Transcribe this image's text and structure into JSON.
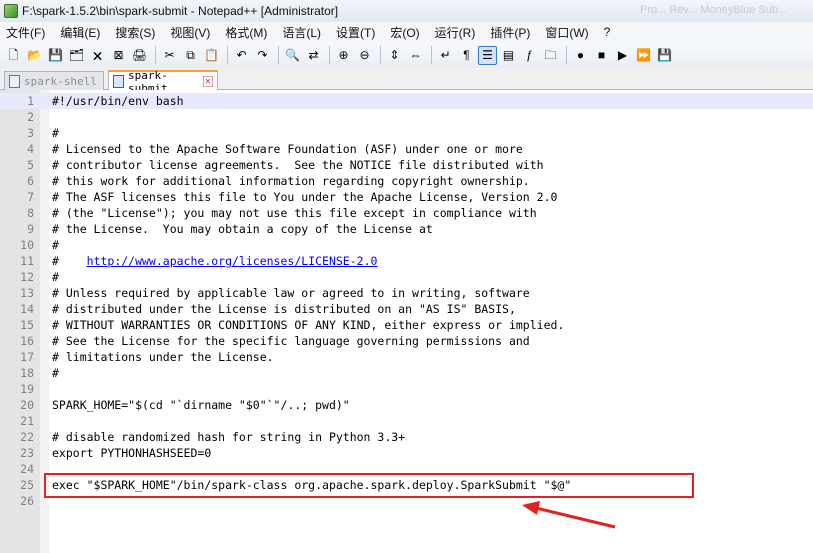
{
  "window": {
    "title": "F:\\spark-1.5.2\\bin\\spark-submit - Notepad++ [Administrator]",
    "ghost_text": "Pro... Rev... MoneyBlue Sub..."
  },
  "menu": [
    "文件(F)",
    "编辑(E)",
    "搜索(S)",
    "视图(V)",
    "格式(M)",
    "语言(L)",
    "设置(T)",
    "宏(O)",
    "运行(R)",
    "插件(P)",
    "窗口(W)",
    "?"
  ],
  "toolbar": {
    "icons": [
      "new-file",
      "open-file",
      "save",
      "save-all",
      "close",
      "close-all",
      "print",
      "sep",
      "cut",
      "copy",
      "paste",
      "sep",
      "undo",
      "redo",
      "sep",
      "find",
      "replace",
      "sep",
      "zoom-in",
      "zoom-out",
      "sep",
      "sync-vertical",
      "sync-horizontal",
      "sep",
      "word-wrap",
      "show-all-chars",
      "indent-guide",
      "doc-map",
      "function-list",
      "folder-workspace",
      "sep",
      "record-macro",
      "stop-record",
      "play-macro",
      "play-multiple",
      "save-macro"
    ],
    "glyphs": {
      "new-file": "🗋",
      "open-file": "📂",
      "save": "💾",
      "save-all": "🗂",
      "close": "🗙",
      "close-all": "⊠",
      "print": "🖨",
      "cut": "✂",
      "copy": "⧉",
      "paste": "📋",
      "undo": "↶",
      "redo": "↷",
      "find": "🔍",
      "replace": "⇄",
      "zoom-in": "⊕",
      "zoom-out": "⊖",
      "sync-vertical": "⇕",
      "sync-horizontal": "⇔",
      "word-wrap": "↵",
      "show-all-chars": "¶",
      "indent-guide": "☰",
      "doc-map": "▤",
      "function-list": "ƒ",
      "folder-workspace": "🗀",
      "record-macro": "●",
      "stop-record": "■",
      "play-macro": "▶",
      "play-multiple": "⏩",
      "save-macro": "💾"
    },
    "active_icon": "indent-guide"
  },
  "tabs": [
    {
      "label": "spark-shell",
      "active": false
    },
    {
      "label": "spark-submit",
      "active": true
    }
  ],
  "editor": {
    "current_line": 1,
    "lines": [
      "#!/usr/bin/env bash",
      "",
      "#",
      "# Licensed to the Apache Software Foundation (ASF) under one or more",
      "# contributor license agreements.  See the NOTICE file distributed with",
      "# this work for additional information regarding copyright ownership.",
      "# The ASF licenses this file to You under the Apache License, Version 2.0",
      "# (the \"License\"); you may not use this file except in compliance with",
      "# the License.  You may obtain a copy of the License at",
      "#",
      "#    http://www.apache.org/licenses/LICENSE-2.0",
      "#",
      "# Unless required by applicable law or agreed to in writing, software",
      "# distributed under the License is distributed on an \"AS IS\" BASIS,",
      "# WITHOUT WARRANTIES OR CONDITIONS OF ANY KIND, either express or implied.",
      "# See the License for the specific language governing permissions and",
      "# limitations under the License.",
      "#",
      "",
      "SPARK_HOME=\"$(cd \"`dirname \"$0\"`\"/..; pwd)\"",
      "",
      "# disable randomized hash for string in Python 3.3+",
      "export PYTHONHASHSEED=0",
      "",
      "exec \"$SPARK_HOME\"/bin/spark-class org.apache.spark.deploy.SparkSubmit \"$@\"",
      ""
    ],
    "link_line": 11,
    "link_prefix": "#    ",
    "link_text": "http://www.apache.org/licenses/LICENSE-2.0",
    "highlighted_line": 25
  },
  "colors": {
    "annotation": "#e0231d",
    "link": "#0000ff",
    "line_number": "#808080"
  }
}
